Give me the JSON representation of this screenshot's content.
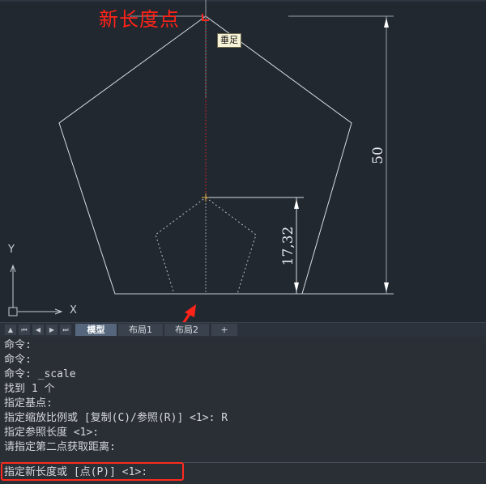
{
  "drawing": {
    "annotation_label": "新长度点",
    "snap_tooltip": "垂足",
    "dimensions": {
      "outer": "50",
      "inner": "17,32"
    },
    "ucs": {
      "x_label": "X",
      "y_label": "Y"
    },
    "colors": {
      "background": "#212830",
      "geometry": "#d8dce2",
      "annotation": "#ff2318",
      "tracking_line": "#c8242a",
      "dashed_preview": "#b8bec6",
      "snap_marker": "#e8b04a"
    }
  },
  "layout_tabs": {
    "nav_buttons": [
      "▲",
      "⏮",
      "◀",
      "▶",
      "⏭"
    ],
    "tabs": [
      {
        "label": "模型",
        "active": true
      },
      {
        "label": "布局1",
        "active": false
      },
      {
        "label": "布局2",
        "active": false
      },
      {
        "label": "+",
        "active": false
      }
    ]
  },
  "command_history": [
    "命令:",
    "命令:",
    "命令: _scale",
    "找到 1 个",
    "指定基点:",
    "指定缩放比例或 [复制(C)/参照(R)] <1>: R",
    "指定参照长度 <1>:",
    "请指定第二点获取距离:"
  ],
  "command_prompt": "指定新长度或 [点(P)] <1>:"
}
